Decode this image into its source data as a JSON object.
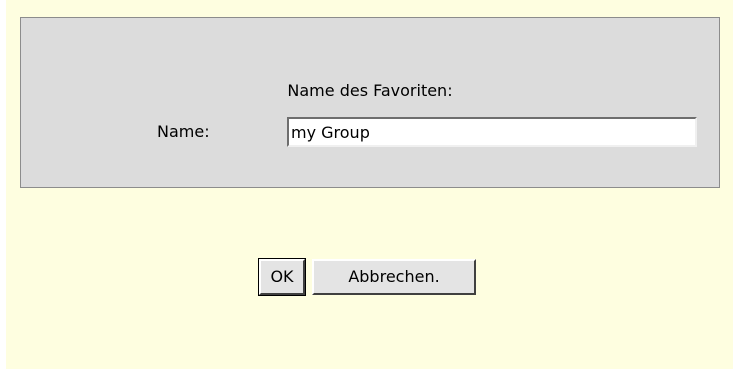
{
  "dialog": {
    "heading": "Name des Favoriten:",
    "name_label": "Name:",
    "name_value": "my Group",
    "ok_label": "OK",
    "cancel_label": "Abbrechen."
  },
  "colors": {
    "dialog_background": "#fefee0",
    "panel_background": "#dcdcdc",
    "button_face": "#e4e4e4"
  }
}
